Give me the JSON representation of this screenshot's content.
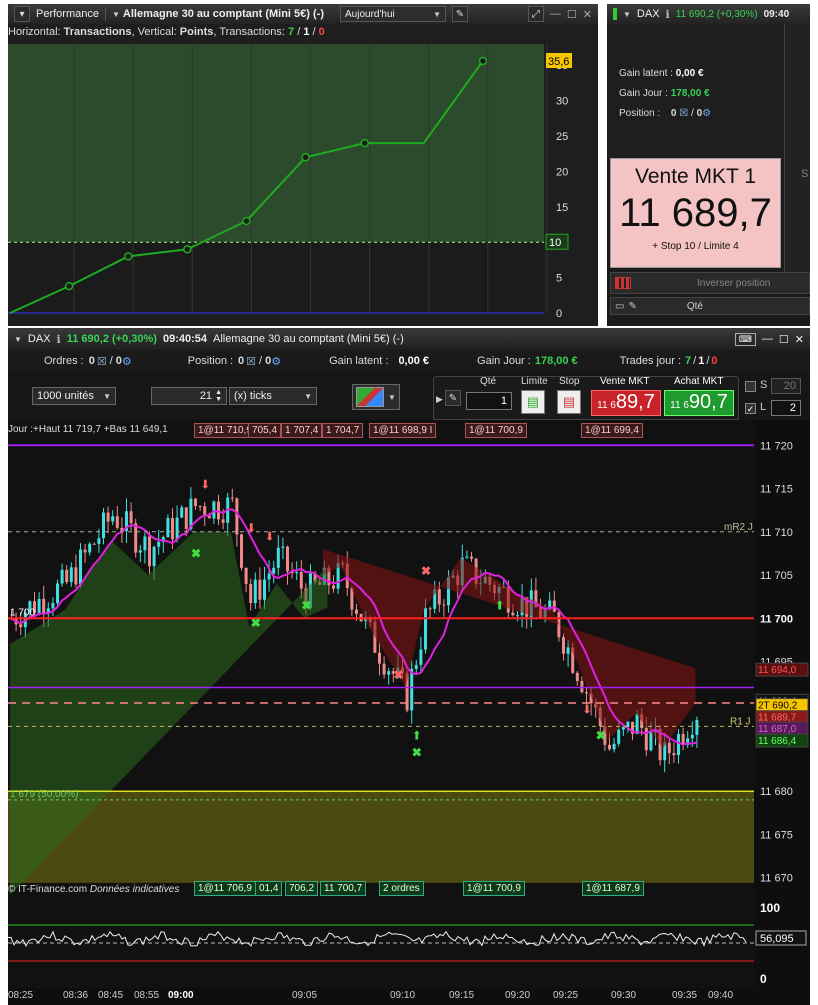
{
  "perf": {
    "title": "Performance",
    "instrument": "Allemagne 30 au comptant (Mini 5€) (-)",
    "period": "Aujourd'hui",
    "subtitle_pre": "Horizontal: ",
    "subtitle_h": "Transactions",
    "subtitle_mid": ", Vertical: ",
    "subtitle_v": "Points",
    "subtitle_post": ", Transactions: ",
    "tx_a": "7",
    "tx_sep1": " / ",
    "tx_b": "1",
    "tx_sep2": " / ",
    "tx_c": "0",
    "yticks": [
      "35",
      "30",
      "25",
      "20",
      "15",
      "10",
      "5",
      "0"
    ],
    "last_value": "35,6",
    "highlight_value": "10"
  },
  "perf_chart_data": {
    "type": "line",
    "x": [
      0,
      1,
      2,
      3,
      4,
      5,
      6,
      7,
      8
    ],
    "values": [
      0,
      3.8,
      8,
      9,
      13,
      22,
      24,
      24,
      35.6
    ],
    "ylim": [
      0,
      38
    ]
  },
  "dax_panel": {
    "title": "DAX",
    "price_line": "11 690,2 (+0,30%)",
    "time": "09:40",
    "gain_latent_label": "Gain latent :",
    "gain_latent_value": "0,00 €",
    "gain_jour_label": "Gain Jour :",
    "gain_jour_value": "178,00 €",
    "position_label": "Position :",
    "position_a": "0",
    "position_b": "0",
    "sell_title": "Vente MKT 1",
    "sell_price": "11 689,7",
    "sell_sub": "+ Stop 10 / Limite 4",
    "reverse_label": "Inverser position",
    "qty_label": "Qté",
    "side_btn": "S"
  },
  "main": {
    "title": "DAX",
    "price": "11 690,2 (+0,30%)",
    "time": "09:40:54",
    "instrument": "Allemagne 30 au comptant (Mini 5€) (-)",
    "orders_label": "Ordres :",
    "orders_a": "0",
    "orders_b": "0",
    "position_label": "Position :",
    "position_a": "0",
    "position_b": "0",
    "gain_latent_label": "Gain latent :",
    "gain_latent_value": "0,00 €",
    "gain_jour_label": "Gain Jour :",
    "gain_jour_value": "178,00 €",
    "trades_label": "Trades jour :",
    "trades_a": "7",
    "trades_b": "1",
    "trades_c": "0",
    "units": "1000 unités",
    "ticks_value": "21",
    "ticks_unit": "(x) ticks",
    "qty_label": "Qté",
    "qty_value": "1",
    "limit_label": "Limite",
    "stop_label": "Stop",
    "sell_label": "Vente MKT",
    "sell_small": "11 6",
    "sell_big": "89,7",
    "buy_label": "Achat MKT",
    "buy_small": "11 6",
    "buy_big": "90,7",
    "s_label": "S",
    "s_value": "20",
    "l_label": "L",
    "l_value": "2",
    "chart_header": "Jour :+Haut 11 719,7 +Bas 11 649,1",
    "top_tags": [
      "1@11 710,9",
      "705,4",
      "1 707,4",
      "1 704,7",
      "1@11 698,9 I",
      "1@11 700,9",
      "1@11 699,4"
    ],
    "bottom_tags": [
      "1@11 706,9",
      "01,4",
      "706,2",
      "11 700,7",
      "2 ordres",
      "1@11 700,9",
      "1@11 687,9"
    ],
    "footer_left": "© IT-Finance.com",
    "footer_note": "Données indicatives",
    "price_axis": [
      "11 720",
      "11 715",
      "11 710",
      "11 705",
      "11 700",
      "11 695",
      "11 690",
      "11 685",
      "11 680",
      "11 675",
      "11 670"
    ],
    "mr2_label": "mR2 J",
    "r1_label": "R1 J",
    "pivot_label": "11 700",
    "left_700": "1 700",
    "left_50": "1 679 (50,00%)",
    "axis_boxes": {
      "b1": "11 694,0",
      "b2": "11 690,4",
      "b3": "2T 690,2",
      "b4": "11 689,7",
      "b5": "11 687,0",
      "b6": "11 686,4"
    },
    "osc_top": "100",
    "osc_value": "56,095",
    "osc_bottom": "0",
    "time_axis": [
      "08:25",
      "08:36",
      "08:45",
      "08:55",
      "09:00",
      "09:05",
      "09:10",
      "09:15",
      "09:20",
      "09:25",
      "09:30",
      "09:35",
      "09:40"
    ],
    "colors": {
      "up": "#40e0e0",
      "down": "#f08a8a",
      "pivot": "#ff2020",
      "purple": "#a020f0",
      "magenta": "#e020e0"
    }
  }
}
